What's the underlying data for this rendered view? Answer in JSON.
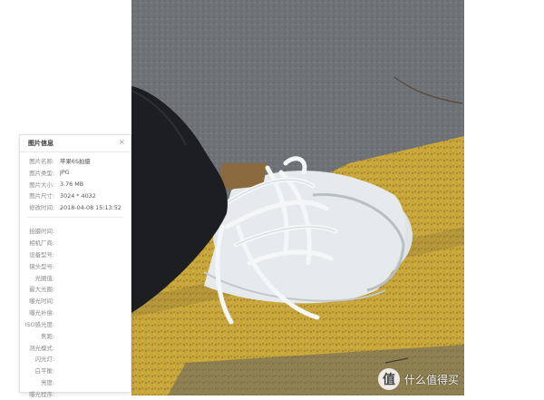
{
  "panel": {
    "title": "图片信息",
    "close_glyph": "×",
    "basic": [
      {
        "key": "图片名称:",
        "value": "苹果6S拍摄"
      },
      {
        "key": "图片类型:",
        "value": "JPG"
      },
      {
        "key": "图片大小:",
        "value": "3.76 MB"
      },
      {
        "key": "图片尺寸:",
        "value": "3024 * 4032"
      },
      {
        "key": "修改时间:",
        "value": "2018-04-08 15:13:52"
      }
    ],
    "exif": [
      {
        "key": "拍摄时间:",
        "value": ""
      },
      {
        "key": "相机厂商:",
        "value": ""
      },
      {
        "key": "设备型号:",
        "value": ""
      },
      {
        "key": "镜头型号:",
        "value": ""
      },
      {
        "key": "光圈值:",
        "value": ""
      },
      {
        "key": "最大光圈:",
        "value": ""
      },
      {
        "key": "曝光时间:",
        "value": ""
      },
      {
        "key": "曝光补偿:",
        "value": ""
      },
      {
        "key": "ISO感光度:",
        "value": ""
      },
      {
        "key": "焦距:",
        "value": ""
      },
      {
        "key": "测光模式:",
        "value": ""
      },
      {
        "key": "闪光灯:",
        "value": ""
      },
      {
        "key": "白平衡:",
        "value": ""
      },
      {
        "key": "亮度:",
        "value": ""
      },
      {
        "key": "曝光程序:",
        "value": ""
      }
    ]
  },
  "watermark": {
    "badge": "值",
    "text": "什么值得买",
    "icon": "smzdm-logo-icon"
  },
  "colors": {
    "asphalt": "#6f7276",
    "yellow_paint": "#c9a63a",
    "pant_black": "#1c1e22",
    "shoe_white": "#e4e8ea"
  }
}
